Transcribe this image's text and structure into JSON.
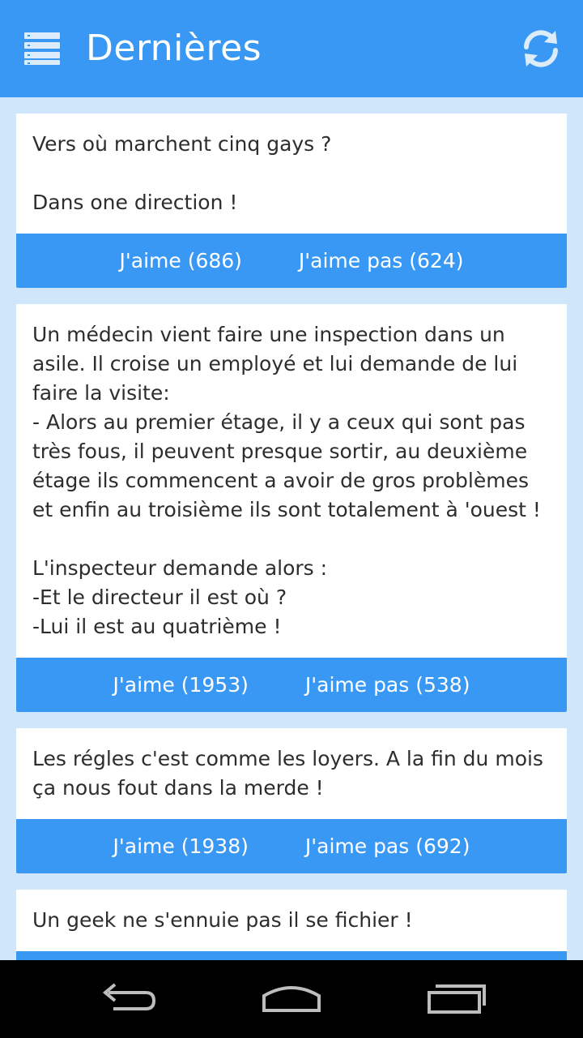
{
  "header": {
    "title": "Dernières",
    "menu_icon": "hamburger-menu-icon",
    "refresh_icon": "refresh-icon"
  },
  "colors": {
    "primary": "#3a98f5",
    "background": "#cfe6fb",
    "card": "#ffffff",
    "navbar": "#000000"
  },
  "jokes": [
    {
      "text": "Vers où marchent cinq gays ?\n\nDans one direction !",
      "like_label": "J'aime (686)",
      "dislike_label": "J'aime pas (624)"
    },
    {
      "text": "Un médecin vient faire une inspection dans un asile. Il croise un employé et lui demande de lui faire la visite:\n- Alors au premier étage, il y a ceux qui sont pas très fous, il peuvent presque sortir, au deuxième étage ils commencent a avoir de gros problèmes et enfin au troisième ils sont totalement à 'ouest !\n\nL'inspecteur demande alors :\n-Et le directeur il est où ?\n-Lui il est au quatrième !",
      "like_label": "J'aime (1953)",
      "dislike_label": "J'aime pas (538)"
    },
    {
      "text": "Les régles c'est comme les loyers. A la fin du mois ça nous fout dans la merde !",
      "like_label": "J'aime (1938)",
      "dislike_label": "J'aime pas (692)"
    },
    {
      "text": "Un geek ne s'ennuie pas il se fichier !",
      "like_label": "",
      "dislike_label": ""
    }
  ],
  "navbar": {
    "back_icon": "back-icon",
    "home_icon": "home-icon",
    "recents_icon": "recent-apps-icon"
  }
}
